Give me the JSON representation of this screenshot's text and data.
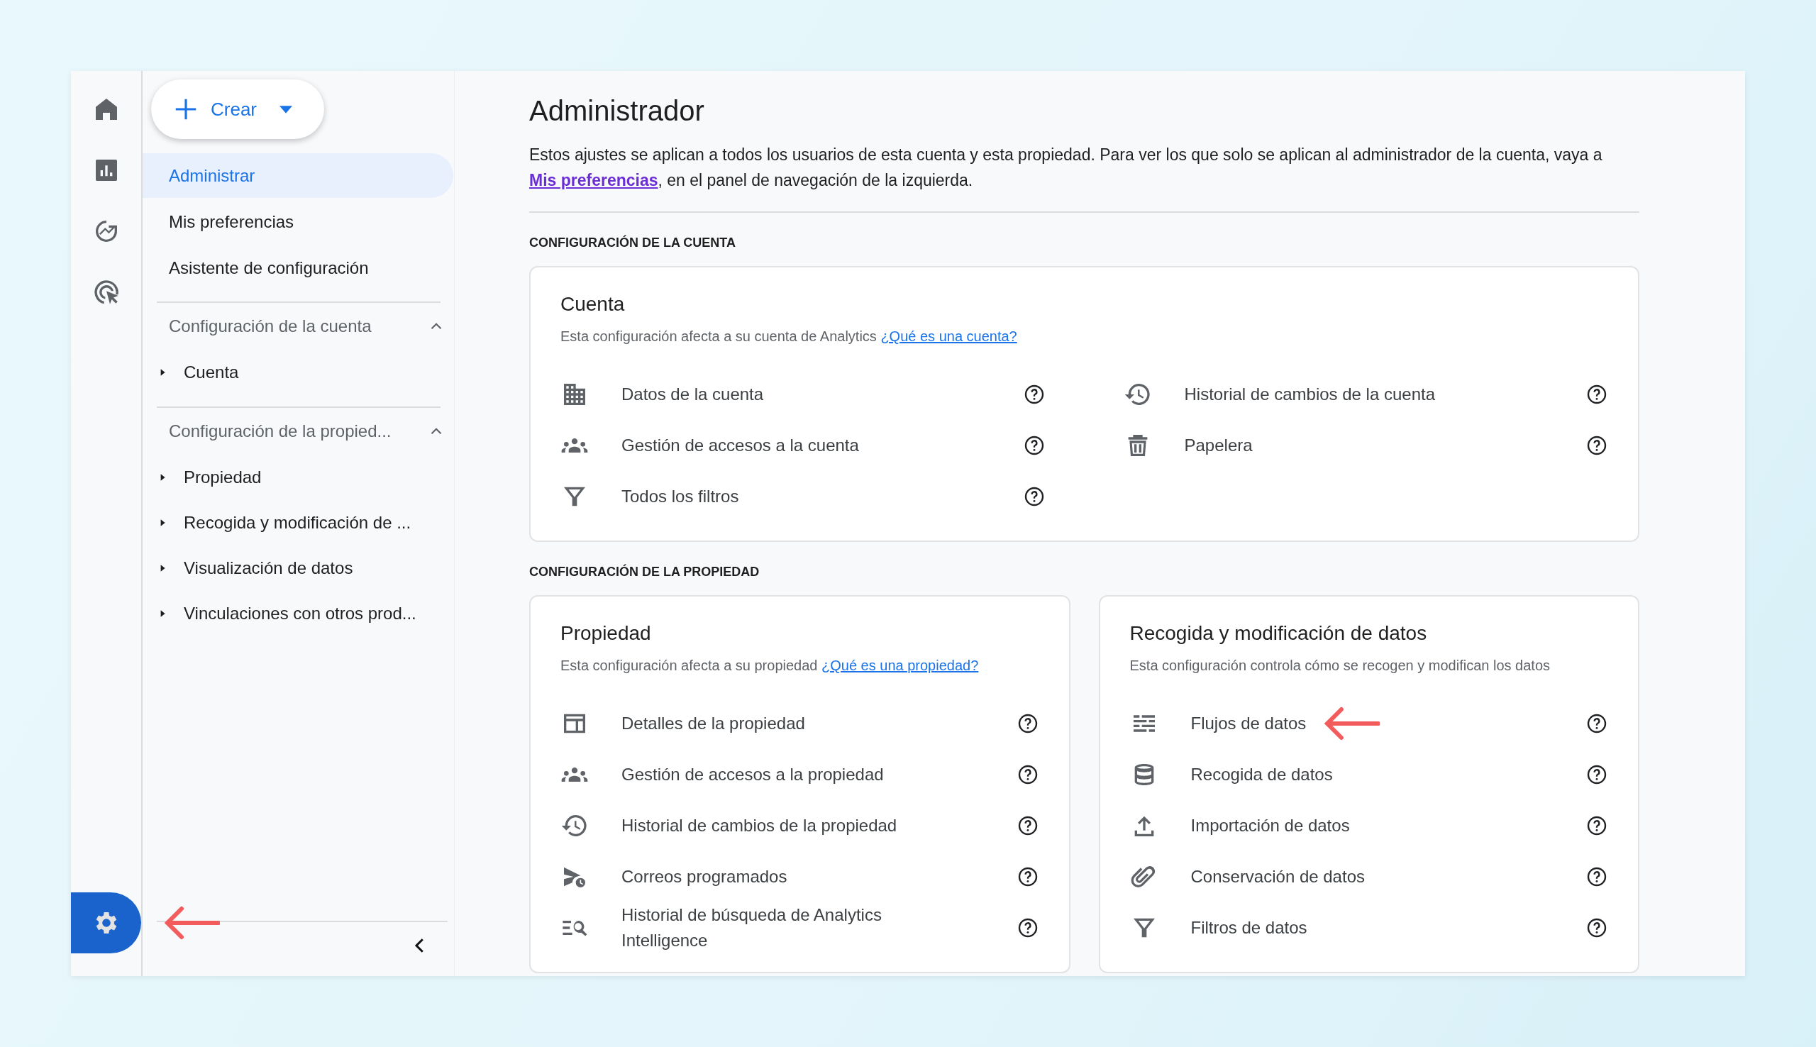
{
  "rail": {
    "items": [
      {
        "selected": false
      },
      {
        "selected": false
      },
      {
        "selected": false
      },
      {
        "selected": false
      }
    ],
    "settings": {
      "selected": true,
      "pointer_arrow": true
    }
  },
  "sidebar": {
    "create_button": "Crear",
    "nav": [
      {
        "label": "Administrar",
        "selected": true
      },
      {
        "label": "Mis preferencias",
        "selected": false
      },
      {
        "label": "Asistente de configuración",
        "selected": false
      }
    ],
    "sections": [
      {
        "title": "Configuración de la cuenta",
        "expanded": true,
        "children": [
          {
            "label": "Cuenta",
            "expanded": false
          }
        ]
      },
      {
        "title": "Configuración de la propied...",
        "expanded": true,
        "children": [
          {
            "label": "Propiedad",
            "expanded": false
          },
          {
            "label": "Recogida y modificación de ...",
            "expanded": false
          },
          {
            "label": "Visualización de datos",
            "expanded": false
          },
          {
            "label": "Vinculaciones con otros prod...",
            "expanded": false
          }
        ]
      }
    ]
  },
  "main": {
    "title": "Administrador",
    "description": {
      "before": "Estos ajustes se aplican a todos los usuarios de esta cuenta y esta propiedad. Para ver los que solo se aplican al administrador de la cuenta, vaya a ",
      "link": "Mis preferencias",
      "after": ", en el panel de navegación de la izquierda."
    },
    "groups": [
      {
        "heading": "CONFIGURACIÓN DE LA CUENTA",
        "cards": [
          {
            "title": "Cuenta",
            "subtitle": "Esta configuración afecta a su cuenta de Analytics ",
            "link": "¿Qué es una cuenta?",
            "items": [
              {
                "label": "Datos de la cuenta",
                "pointer_arrow": false
              },
              {
                "label": "Historial de cambios de la cuenta",
                "pointer_arrow": false
              },
              {
                "label": "Gestión de accesos a la cuenta",
                "pointer_arrow": false
              },
              {
                "label": "Papelera",
                "pointer_arrow": false
              },
              {
                "label": "Todos los filtros",
                "pointer_arrow": false
              }
            ]
          }
        ]
      },
      {
        "heading": "CONFIGURACIÓN DE LA PROPIEDAD",
        "cards": [
          {
            "title": "Propiedad",
            "subtitle": "Esta configuración afecta a su propiedad ",
            "link": "¿Qué es una propiedad?",
            "items": [
              {
                "label": "Detalles de la propiedad",
                "pointer_arrow": false
              },
              {
                "label": "Gestión de accesos a la propiedad",
                "pointer_arrow": false
              },
              {
                "label": "Historial de cambios de la propiedad",
                "pointer_arrow": false
              },
              {
                "label": "Correos programados",
                "pointer_arrow": false
              },
              {
                "label": "Historial de búsqueda de Analytics Intelligence",
                "pointer_arrow": false
              }
            ]
          },
          {
            "title": "Recogida y modificación de datos",
            "subtitle": "Esta configuración controla cómo se recogen y modifican los datos",
            "items": [
              {
                "label": "Flujos de datos",
                "pointer_arrow": true
              },
              {
                "label": "Recogida de datos",
                "pointer_arrow": false
              },
              {
                "label": "Importación de datos",
                "pointer_arrow": false
              },
              {
                "label": "Conservación de datos",
                "pointer_arrow": false
              },
              {
                "label": "Filtros de datos",
                "pointer_arrow": false
              }
            ]
          }
        ]
      }
    ]
  }
}
